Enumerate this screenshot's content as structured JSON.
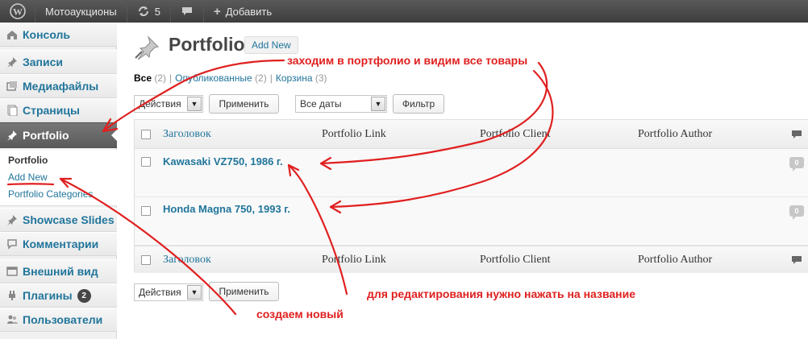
{
  "admin_bar": {
    "site_name": "Мотоаукционы",
    "updates_count": "5",
    "add_label": "Добавить"
  },
  "sidebar": {
    "items": [
      {
        "label": "Консоль",
        "icon": "dashboard-icon"
      },
      {
        "label": "Записи",
        "icon": "pin-icon"
      },
      {
        "label": "Медиафайлы",
        "icon": "media-icon"
      },
      {
        "label": "Страницы",
        "icon": "pages-icon"
      },
      {
        "label": "Portfolio",
        "icon": "pin-icon"
      },
      {
        "label": "Showcase Slides",
        "icon": "pin-icon"
      },
      {
        "label": "Комментарии",
        "icon": "comments-icon"
      },
      {
        "label": "Внешний вид",
        "icon": "appearance-icon"
      },
      {
        "label": "Плагины",
        "icon": "plugins-icon",
        "badge": "2"
      },
      {
        "label": "Пользователи",
        "icon": "users-icon"
      }
    ],
    "submenu": [
      {
        "label": "Portfolio"
      },
      {
        "label": "Add New"
      },
      {
        "label": "Portfolio Categories"
      }
    ]
  },
  "page": {
    "title": "Portfolio",
    "add_new": "Add New",
    "filters": {
      "all": "Все",
      "all_count": "(2)",
      "published": "Опубликованные",
      "published_count": "(2)",
      "trash": "Корзина",
      "trash_count": "(3)",
      "separator": "|"
    },
    "bulk_action_top": "Действия",
    "apply_top": "Применить",
    "dates": "Все даты",
    "filter_button": "Фильтр",
    "bulk_action_bottom": "Действия",
    "apply_bottom": "Применить"
  },
  "table": {
    "columns": [
      "Заголовок",
      "Portfolio Link",
      "Portfolio Client",
      "Portfolio Author"
    ],
    "rows": [
      {
        "title": "Kawasaki VZ750, 1986 г.",
        "comments": "0"
      },
      {
        "title": "Honda Magna 750, 1993 г.",
        "comments": "0"
      }
    ]
  },
  "annotations": {
    "note_portfolio": "заходим в портфолио и видим все товары",
    "note_edit": "для редактирования нужно нажать на название",
    "note_create": "создаем новый",
    "color": "#e02020"
  }
}
